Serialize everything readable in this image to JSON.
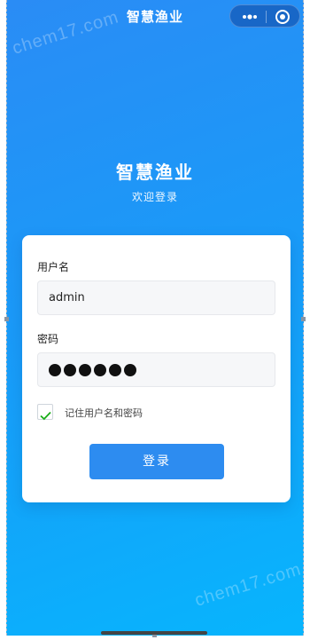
{
  "nav": {
    "title": "智慧渔业",
    "more_icon": "more-dots-icon",
    "close_icon": "target-circle-icon"
  },
  "watermark": "chem17.com",
  "hero": {
    "title": "智慧渔业",
    "subtitle": "欢迎登录"
  },
  "form": {
    "username_label": "用户名",
    "username_value": "admin",
    "password_label": "密码",
    "password_value": "●●●●●●",
    "remember_label": "记住用户名和密码",
    "remember_checked": true,
    "submit_label": "登录"
  },
  "colors": {
    "gradient_start": "#2a8cf5",
    "gradient_end": "#07b5fd",
    "button": "#2d8cf0",
    "check": "#1aad19"
  }
}
